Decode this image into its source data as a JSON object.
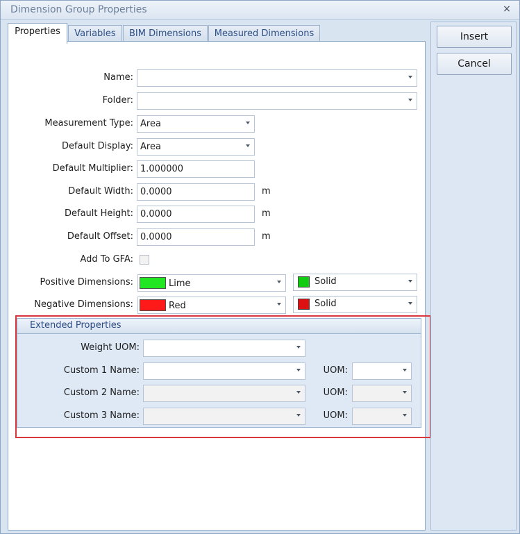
{
  "window": {
    "title": "Dimension Group Properties",
    "close_label": "×"
  },
  "tabs": [
    {
      "label": "Properties",
      "active": true
    },
    {
      "label": "Variables"
    },
    {
      "label": "BIM Dimensions"
    },
    {
      "label": "Measured Dimensions"
    }
  ],
  "buttons": {
    "insert": "Insert",
    "cancel": "Cancel"
  },
  "form": {
    "name": {
      "label": "Name:",
      "value": ""
    },
    "folder": {
      "label": "Folder:",
      "value": ""
    },
    "measurement_type": {
      "label": "Measurement Type:",
      "value": "Area"
    },
    "default_display": {
      "label": "Default Display:",
      "value": "Area"
    },
    "default_multiplier": {
      "label": "Default Multiplier:",
      "value": "1.000000"
    },
    "default_width": {
      "label": "Default Width:",
      "value": "0.0000",
      "unit": "m"
    },
    "default_height": {
      "label": "Default Height:",
      "value": "0.0000",
      "unit": "m"
    },
    "default_offset": {
      "label": "Default Offset:",
      "value": "0.0000",
      "unit": "m"
    },
    "add_to_gfa": {
      "label": "Add To GFA:",
      "checked": false
    },
    "positive_dimensions": {
      "label": "Positive Dimensions:",
      "color_name": "Lime",
      "color": "#22e622",
      "pattern": "Solid",
      "pattern_color": "#11cc11"
    },
    "negative_dimensions": {
      "label": "Negative Dimensions:",
      "color_name": "Red",
      "color": "#ff1a1a",
      "pattern": "Solid",
      "pattern_color": "#dd1111"
    }
  },
  "extended": {
    "title": "Extended Properties",
    "weight_uom": {
      "label": "Weight UOM:",
      "value": ""
    },
    "custom1": {
      "label": "Custom 1 Name:",
      "value": "",
      "uom_label": "UOM:",
      "uom": ""
    },
    "custom2": {
      "label": "Custom 2 Name:",
      "value": "",
      "uom_label": "UOM:",
      "uom": ""
    },
    "custom3": {
      "label": "Custom 3 Name:",
      "value": "",
      "uom_label": "UOM:",
      "uom": ""
    }
  },
  "colors": {
    "accent": "#2a4a83",
    "highlight": "#d9363e"
  }
}
